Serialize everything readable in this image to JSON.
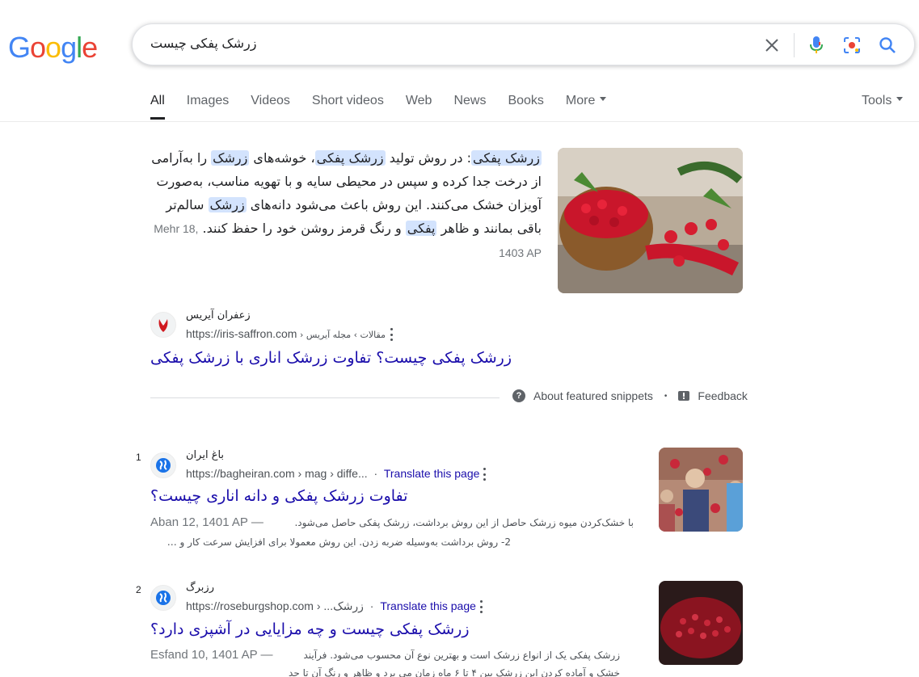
{
  "logo": {
    "letters": [
      "G",
      "o",
      "o",
      "g",
      "l",
      "e"
    ],
    "colors": [
      "#4285F4",
      "#EA4335",
      "#FBBC05",
      "#4285F4",
      "#34A853",
      "#EA4335"
    ]
  },
  "search": {
    "query": "زرشک پفکی چیست",
    "icons": [
      "close-icon",
      "mic-icon",
      "lens-icon",
      "search-icon"
    ]
  },
  "tabs": [
    {
      "label": "All",
      "active": true
    },
    {
      "label": "Images"
    },
    {
      "label": "Videos"
    },
    {
      "label": "Short videos"
    },
    {
      "label": "Web"
    },
    {
      "label": "News"
    },
    {
      "label": "Books"
    },
    {
      "label": "More"
    }
  ],
  "tools_label": "Tools",
  "featured": {
    "parts": [
      {
        "text": "زرشک پفکی",
        "hl": true
      },
      {
        "text": ": در روش تولید "
      },
      {
        "text": "زرشک پفکی",
        "hl": true
      },
      {
        "text": "، خوشه‌های "
      },
      {
        "text": "زرشک",
        "hl": true
      },
      {
        "text": " را به‌آرامی از درخت جدا کرده و سپس در محیطی سایه و با تهویه مناسب، به‌صورت آویزان خشک می‌کنند. این روش باعث می‌شود دانه‌های "
      },
      {
        "text": "زرشک",
        "hl": true
      },
      {
        "text": " سالم‌تر باقی بمانند و ظاهر "
      },
      {
        "text": "پفکی",
        "hl": true
      },
      {
        "text": " و رنگ قرمز روشن خود را حفظ کنند."
      }
    ],
    "date": "Mehr 18, 1403 AP",
    "site_name": "زعفران آیریس",
    "url": "https://iris-saffron.com",
    "crumbs": " › مقالات › مجله آیریس",
    "title": "زرشک پفکی چیست؟ تفاوت زرشک اناری با زرشک پفکی",
    "about": "About featured snippets",
    "feedback": "Feedback",
    "bullet": "•"
  },
  "results": [
    {
      "rank": "1",
      "site_name": "باغ ایران",
      "url": "https://bagheiran.com › mag › diffe...",
      "translate": "Translate this page",
      "sep": "·",
      "title": "تفاوت زرشک پفکی و دانه اناری چیست؟",
      "date": "Aban 12, 1401 AP —",
      "desc1": "با خشک‌کردن میوه زرشک حاصل از این روش برداشت، زرشک پفکی حاصل می‌شود.",
      "desc2": "2- روش برداشت به‌وسیله ضربه زدن. این روش معمولا برای افزایش سرعت کار و …"
    },
    {
      "rank": "2",
      "site_name": "رزبرگ",
      "url": "https://roseburgshop.com › ...زرشک",
      "translate": "Translate this page",
      "sep": "·",
      "title": "زرشک پفکی چیست و چه مزایایی در آشپزی دارد؟",
      "date": "Esfand 10, 1401 AP —",
      "desc1": "زرشک پفکی یک از انواع زرشک است و بهترین نوع آن محسوب می‌شود. فرآیند",
      "desc2": "خشک و آماده کردن این زرشک بین ۴ تا ۶ ماه زمان می برد و ظاهر و رنگ آن تا حد"
    }
  ]
}
